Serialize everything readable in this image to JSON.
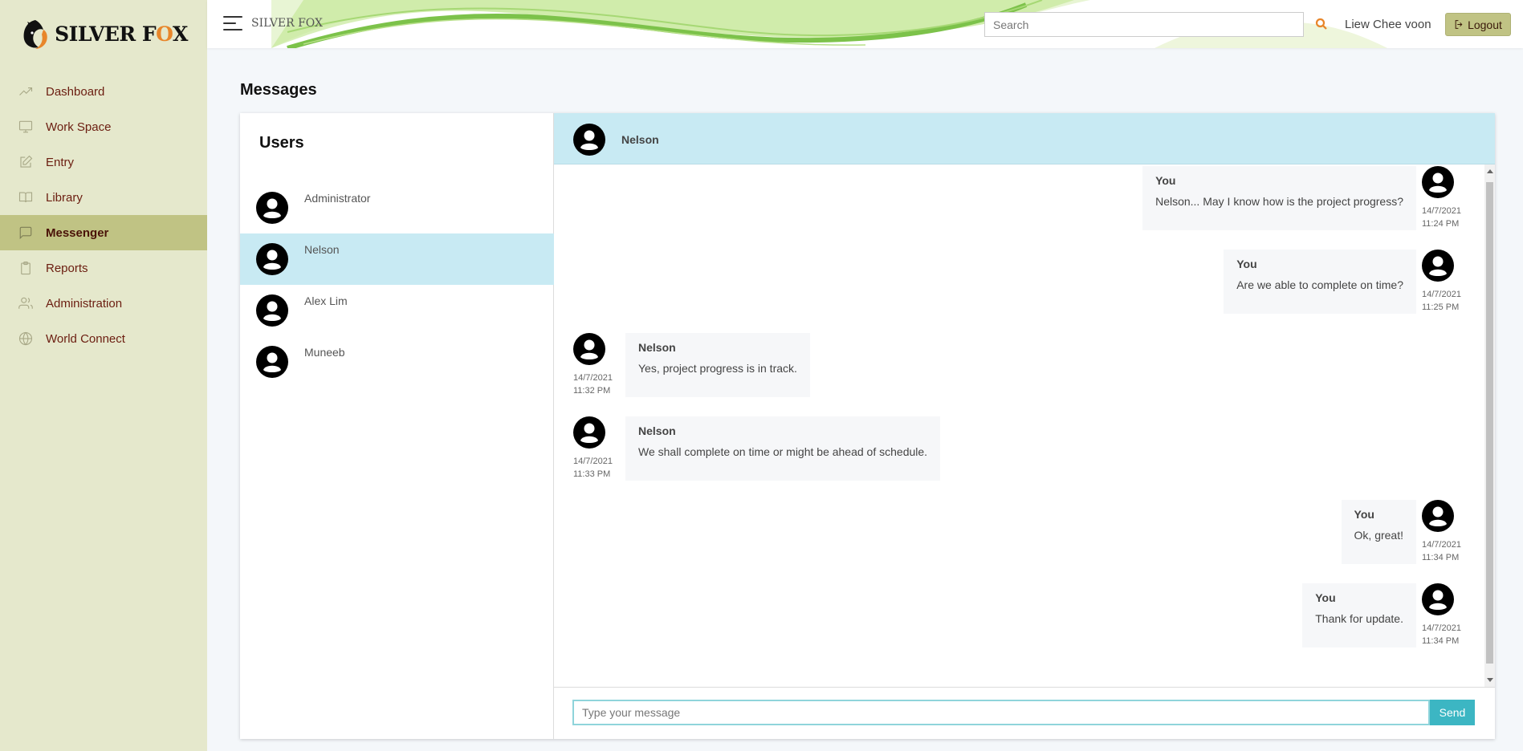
{
  "brand": {
    "logo_text_main": "SILVER F",
    "logo_text_accent": "O",
    "logo_text_end": "X",
    "header_name": "SILVER FOX"
  },
  "colors": {
    "sidebar_bg": "#e5e8cc",
    "sidebar_active": "#c0c384",
    "chat_highlight": "#c8eaf3",
    "send_button": "#3cb6c3",
    "search_icon": "#e8862a"
  },
  "sidebar": {
    "items": [
      {
        "label": "Dashboard",
        "icon": "trend-icon"
      },
      {
        "label": "Work Space",
        "icon": "monitor-icon"
      },
      {
        "label": "Entry",
        "icon": "edit-icon"
      },
      {
        "label": "Library",
        "icon": "book-icon"
      },
      {
        "label": "Messenger",
        "icon": "chat-icon",
        "active": true
      },
      {
        "label": "Reports",
        "icon": "clipboard-icon"
      },
      {
        "label": "Administration",
        "icon": "users-icon"
      },
      {
        "label": "World Connect",
        "icon": "globe-icon"
      }
    ]
  },
  "header": {
    "search_placeholder": "Search",
    "user_name": "Liew Chee voon",
    "logout_label": "Logout"
  },
  "page": {
    "title": "Messages"
  },
  "users": {
    "title": "Users",
    "list": [
      {
        "name": "Administrator"
      },
      {
        "name": "Nelson",
        "active": true
      },
      {
        "name": "Alex Lim"
      },
      {
        "name": "Muneeb"
      }
    ]
  },
  "chat": {
    "contact": "Nelson",
    "messages": [
      {
        "sender": "You",
        "text": "Nelson... May I know how is the project progress?",
        "date": "14/7/2021",
        "time": "11:24 PM",
        "outgoing": true
      },
      {
        "sender": "You",
        "text": "Are we able to complete on time?",
        "date": "14/7/2021",
        "time": "11:25 PM",
        "outgoing": true
      },
      {
        "sender": "Nelson",
        "text": "Yes, project progress is in track.",
        "date": "14/7/2021",
        "time": "11:32 PM",
        "outgoing": false
      },
      {
        "sender": "Nelson",
        "text": "We shall complete on time or might be ahead of schedule.",
        "date": "14/7/2021",
        "time": "11:33 PM",
        "outgoing": false
      },
      {
        "sender": "You",
        "text": "Ok, great!",
        "date": "14/7/2021",
        "time": "11:34 PM",
        "outgoing": true
      },
      {
        "sender": "You",
        "text": "Thank for update.",
        "date": "14/7/2021",
        "time": "11:34 PM",
        "outgoing": true
      }
    ],
    "input_placeholder": "Type your message",
    "send_label": "Send"
  }
}
